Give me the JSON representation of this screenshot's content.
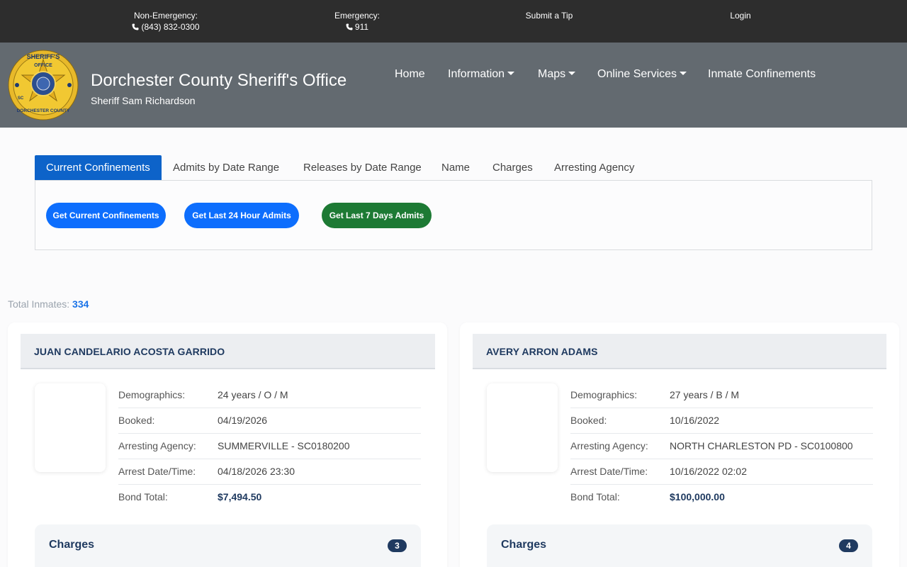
{
  "topbar": {
    "non_emergency_label": "Non-Emergency:",
    "non_emergency_phone": "(843) 832-0300",
    "emergency_label": "Emergency:",
    "emergency_phone": "911",
    "submit_tip": "Submit a Tip",
    "login": "Login"
  },
  "header": {
    "logo_text": [
      "SHERIFF'S",
      "OFFICE",
      "DORCHESTER COUNTY",
      "SC"
    ],
    "title": "Dorchester County Sheriff's Office",
    "subtitle": "Sheriff Sam Richardson",
    "nav": [
      "Home",
      "Information",
      "Maps",
      "Online Services",
      "Inmate Confinements"
    ]
  },
  "tabs": [
    "Current Confinements",
    "Admits by Date Range",
    "Releases by Date Range",
    "Name",
    "Charges",
    "Arresting Agency"
  ],
  "buttons": {
    "current": "Get Current Confinements",
    "last24": "Get Last 24 Hour Admits",
    "last7": "Get Last 7 Days Admits"
  },
  "total": {
    "label": "Total Inmates:",
    "count": "334"
  },
  "field_labels": {
    "demographics": "Demographics:",
    "booked": "Booked:",
    "agency": "Arresting Agency:",
    "arrest": "Arrest Date/Time:",
    "bond": "Bond Total:",
    "charges": "Charges"
  },
  "inmates": [
    {
      "name": "JUAN CANDELARIO ACOSTA GARRIDO",
      "demographics": "24 years / O / M",
      "booked": "04/19/2026",
      "agency": "SUMMERVILLE - SC0180200",
      "arrest": "04/18/2026 23:30",
      "bond": "$7,494.50",
      "charges_count": "3"
    },
    {
      "name": "AVERY ARRON ADAMS",
      "demographics": "27 years / B / M",
      "booked": "10/16/2022",
      "agency": "NORTH CHARLESTON PD - SC0100800",
      "arrest": "10/16/2022 02:02",
      "bond": "$100,000.00",
      "charges_count": "4"
    }
  ],
  "colors": {
    "topbar": "#2d2d2d",
    "header": "#636a70",
    "tab_active": "#0d63c9",
    "pill_blue": "#0d6efd",
    "pill_green": "#1d7a34",
    "navy": "#1f3a60"
  }
}
